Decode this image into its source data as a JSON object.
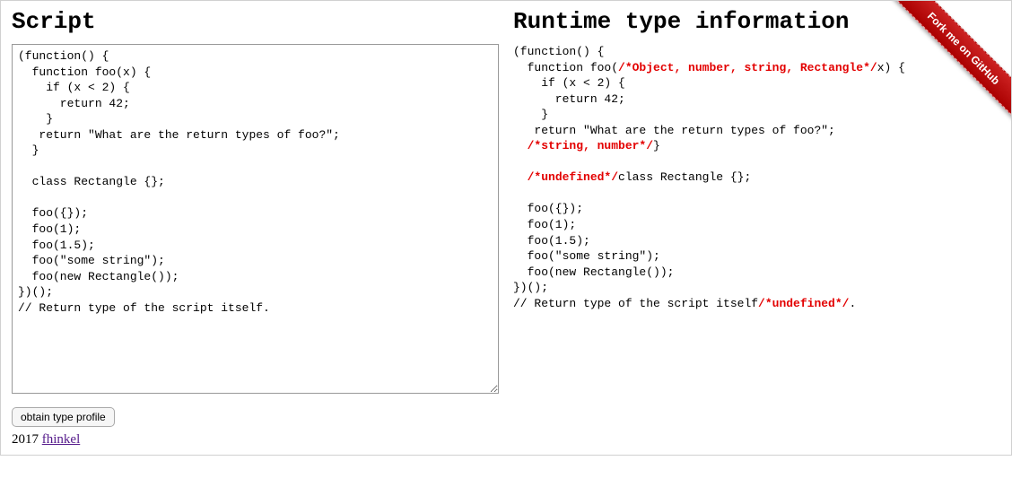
{
  "left": {
    "heading": "Script",
    "textarea_value": "(function() {\n  function foo(x) {\n    if (x < 2) {\n      return 42;\n    }\n   return \"What are the return types of foo?\";\n  }\n\n  class Rectangle {};\n\n  foo({});\n  foo(1);\n  foo(1.5);\n  foo(\"some string\");\n  foo(new Rectangle());\n})();\n// Return type of the script itself."
  },
  "right": {
    "heading": "Runtime type information",
    "segments": [
      {
        "t": "(function() {\n  function foo("
      },
      {
        "t": "/*Object, number, string, Rectangle*/",
        "ann": true
      },
      {
        "t": "x) {\n    if (x < 2) {\n      return 42;\n    }\n   return \"What are the return types of foo?\";\n  "
      },
      {
        "t": "/*string, number*/",
        "ann": true
      },
      {
        "t": "}\n\n  "
      },
      {
        "t": "/*undefined*/",
        "ann": true
      },
      {
        "t": "class Rectangle {};\n\n  foo({});\n  foo(1);\n  foo(1.5);\n  foo(\"some string\");\n  foo(new Rectangle());\n})();\n// Return type of the script itself"
      },
      {
        "t": "/*undefined*/",
        "ann": true
      },
      {
        "t": "."
      }
    ]
  },
  "button": {
    "label": "obtain type profile"
  },
  "footer": {
    "year": "2017",
    "link_text": "fhinkel"
  },
  "github_ribbon": {
    "label": "Fork me on GitHub"
  },
  "colors": {
    "annotation": "#e30000",
    "ribbon_bg": "#a00000",
    "link": "#551a8b"
  }
}
